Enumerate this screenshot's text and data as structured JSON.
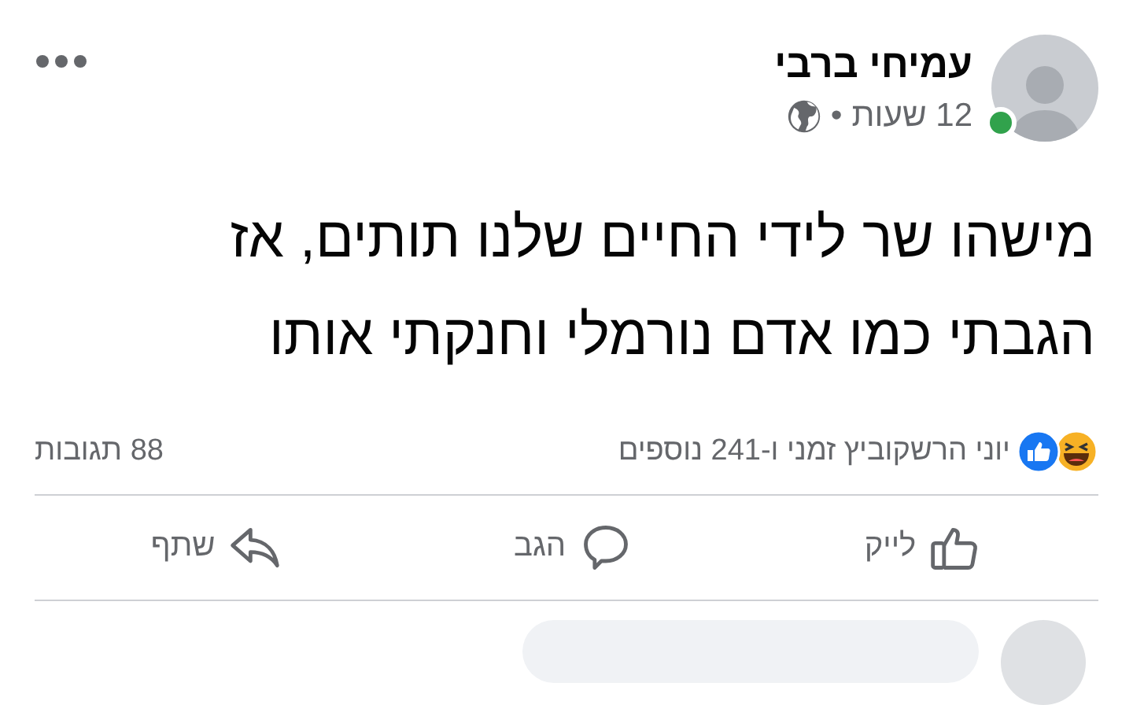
{
  "post": {
    "author": "עמיחי ברבי",
    "author_online": true,
    "time": "12 שעות",
    "separator": "•",
    "text": "מישהו שר לידי החיים שלנו תותים, אז\nהגבתי כמו אדם נורמלי וחנקתי אותו"
  },
  "reactions": {
    "summary": "יוני הרשקוביץ זמני ו-241 נוספים",
    "comments": "88 תגובות"
  },
  "actions": [
    {
      "kind": "like",
      "label": "לייק"
    },
    {
      "kind": "comment",
      "label": "הגב"
    },
    {
      "kind": "share",
      "label": "שתף"
    }
  ]
}
